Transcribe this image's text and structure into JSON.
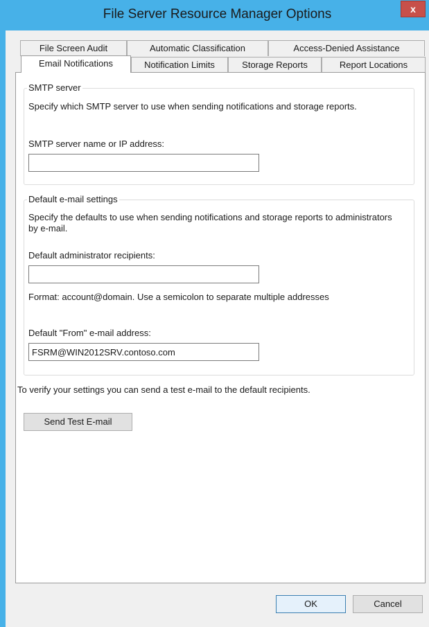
{
  "window": {
    "title": "File Server Resource Manager Options",
    "close_glyph": "x"
  },
  "tabs": {
    "row1": [
      "File Screen Audit",
      "Automatic Classification",
      "Access-Denied Assistance"
    ],
    "row2": [
      "Email Notifications",
      "Notification Limits",
      "Storage Reports",
      "Report Locations"
    ],
    "active": "Email Notifications"
  },
  "smtp": {
    "group_label": "SMTP server",
    "description": "Specify which SMTP server to use when sending notifications and storage reports.",
    "field_label": "SMTP server name or IP address:",
    "value": ""
  },
  "defaults": {
    "group_label": "Default e-mail settings",
    "description": "Specify the defaults to use when sending notifications and storage reports to administrators by e-mail.",
    "recipients_label": "Default administrator recipients:",
    "recipients_value": "",
    "format_hint": "Format: account@domain. Use a semicolon to separate multiple addresses",
    "from_label": "Default \"From\" e-mail address:",
    "from_value": "FSRM@WIN2012SRV.contoso.com"
  },
  "test": {
    "description": "To verify your settings you can send a test e-mail to the default recipients.",
    "button_label": "Send Test E-mail"
  },
  "footer": {
    "ok_label": "OK",
    "cancel_label": "Cancel"
  },
  "colors": {
    "titlebar": "#47b1e8",
    "close": "#c7504a",
    "dialog_bg": "#f0f0f0"
  }
}
